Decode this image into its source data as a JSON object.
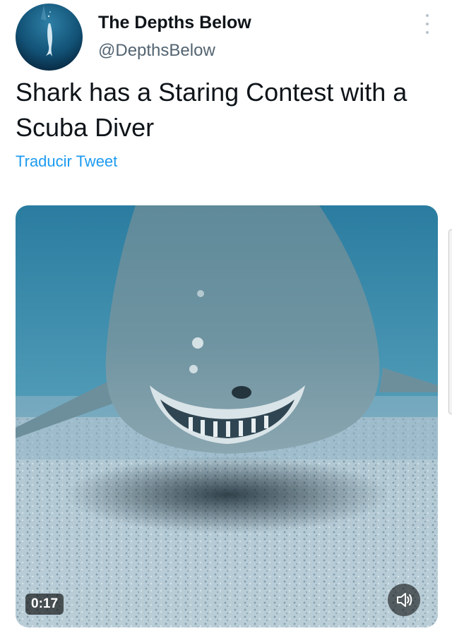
{
  "author": {
    "display_name": "The Depths Below",
    "handle": "@DepthsBelow",
    "avatar_icon": "whale-silhouette-avatar"
  },
  "tweet": {
    "text": "Shark has a Staring Contest with a Scuba Diver",
    "translate_label": "Traducir Tweet"
  },
  "media": {
    "type": "video",
    "duration": "0:17",
    "volume_icon": "speaker-icon"
  },
  "colors": {
    "link": "#1d9bf0",
    "name": "#0f1419",
    "handle": "#536471",
    "water": "#3f90ad",
    "sand": "#b9ccd6"
  }
}
